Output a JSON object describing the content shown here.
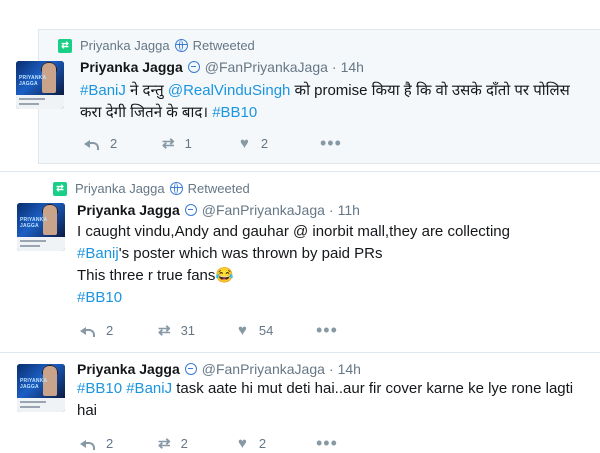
{
  "tweets": [
    {
      "retweet_user": "Priyanka Jagga",
      "retweet_label": "Retweeted",
      "name": "Priyanka Jagga",
      "handle": "@FanPriyankaJaga",
      "time": "14h",
      "text_parts": [
        {
          "t": "#BaniJ",
          "tag": true
        },
        {
          "t": "  ने दन्तु ",
          "tag": false
        },
        {
          "t": "@RealVinduSingh",
          "tag": true
        },
        {
          "t": " को promise किया है कि वो उसके दाँतो पर पोलिस करा देगी जितने के बाद। ",
          "tag": false
        },
        {
          "t": "#BB10",
          "tag": true
        }
      ],
      "replies": "2",
      "retweets": "1",
      "likes": "2"
    },
    {
      "retweet_user": "Priyanka Jagga",
      "retweet_label": "Retweeted",
      "name": "Priyanka Jagga",
      "handle": "@FanPriyankaJaga",
      "time": "11h",
      "text_lines": [
        [
          {
            "t": "I caught vindu,Andy and gauhar @ inorbit mall,they are collecting",
            "tag": false
          }
        ],
        [
          {
            "t": "#Banij",
            "tag": true
          },
          {
            "t": "'s poster which was thrown by paid PRs",
            "tag": false
          }
        ],
        [
          {
            "t": "This three r true fans😂",
            "tag": false
          }
        ],
        [
          {
            "t": "#BB10",
            "tag": true
          }
        ]
      ],
      "replies": "2",
      "retweets": "31",
      "likes": "54"
    },
    {
      "name": "Priyanka Jagga",
      "handle": "@FanPriyankaJaga",
      "time": "14h",
      "text_parts": [
        {
          "t": "#BB10",
          "tag": true
        },
        {
          "t": " ",
          "tag": false
        },
        {
          "t": "#BaniJ",
          "tag": true
        },
        {
          "t": "  task aate hi mut deti hai..aur fir cover karne ke lye rone lagti hai",
          "tag": false
        }
      ],
      "replies": "2",
      "retweets": "2",
      "likes": "2"
    }
  ],
  "icons": {
    "retweet_badge": "retweet-badge-icon",
    "globe": "globe-icon",
    "verified": "verified-icon",
    "reply": "reply-icon",
    "retweet": "retweet-icon",
    "like": "heart-icon",
    "more": "more-icon"
  },
  "colors": {
    "link": "#1b95e0",
    "meta": "#657786",
    "retweet_green": "#19cf86",
    "highlight_bg": "#f5f8fa"
  },
  "avatar_brand": "PRIYANKA JAGGA"
}
